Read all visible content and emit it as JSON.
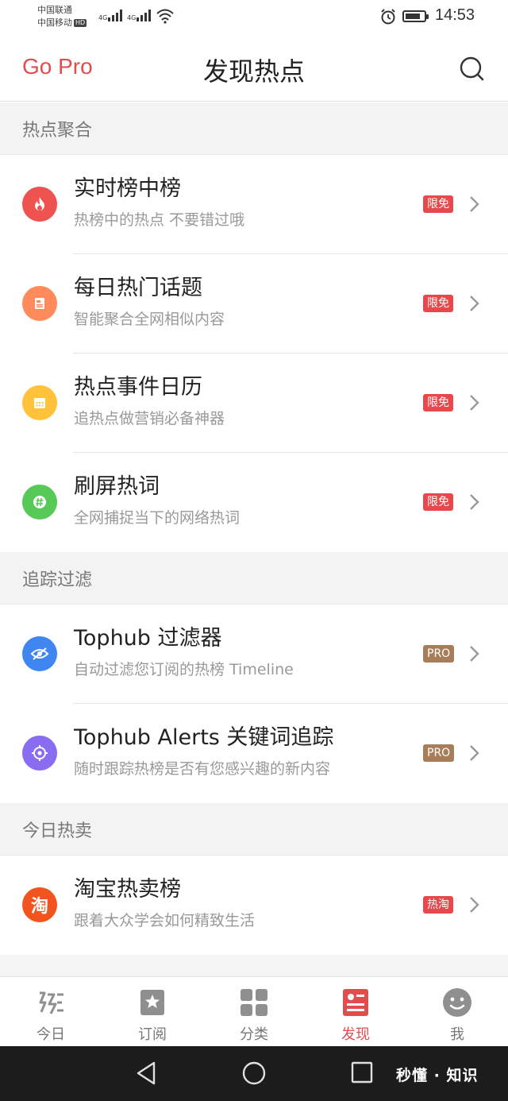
{
  "status_bar": {
    "carrier1": "中国联通",
    "carrier2": "中国移动",
    "hd": "HD",
    "net1": "4G",
    "net2": "4G",
    "time": "14:53",
    "battery_level": 0.8
  },
  "nav": {
    "go_pro": "Go Pro",
    "title": "发现热点",
    "search_icon": "search-icon"
  },
  "sections": [
    {
      "title": "热点聚合",
      "items": [
        {
          "title": "实时榜中榜",
          "subtitle": "热榜中的热点 不要错过哦",
          "badge": "限免",
          "icon": "flame-icon",
          "color": "#ef5350"
        },
        {
          "title": "每日热门话题",
          "subtitle": "智能聚合全网相似内容",
          "badge": "限免",
          "icon": "document-icon",
          "color": "#ff8a5b"
        },
        {
          "title": "热点事件日历",
          "subtitle": "追热点做营销必备神器",
          "badge": "限免",
          "icon": "calendar-icon",
          "color": "#ffc23a"
        },
        {
          "title": "刷屏热词",
          "subtitle": "全网捕捉当下的网络热词",
          "badge": "限免",
          "icon": "hashtag-icon",
          "color": "#56c957"
        }
      ]
    },
    {
      "title": "追踪过滤",
      "items": [
        {
          "title": "Tophub 过滤器",
          "subtitle": "自动过滤您订阅的热榜 Timeline",
          "badge": "PRO",
          "icon": "eye-off-icon",
          "color": "#3f86f0"
        },
        {
          "title": "Tophub Alerts 关键词追踪",
          "subtitle": "随时跟踪热榜是否有您感兴趣的新内容",
          "badge": "PRO",
          "icon": "target-icon",
          "color": "#8a6cf0"
        }
      ]
    },
    {
      "title": "今日热卖",
      "items": [
        {
          "title": "淘宝热卖榜",
          "subtitle": "跟着大众学会如何精致生活",
          "badge": "热淘",
          "icon": "taobao-icon",
          "icon_text": "淘",
          "color": "#f2541f"
        }
      ]
    }
  ],
  "tabs": [
    {
      "label": "今日",
      "icon": "today-icon"
    },
    {
      "label": "订阅",
      "icon": "star-bookmark-icon"
    },
    {
      "label": "分类",
      "icon": "grid-icon"
    },
    {
      "label": "发现",
      "icon": "discover-icon",
      "active": true
    },
    {
      "label": "我",
      "icon": "smiley-icon"
    }
  ],
  "system_nav": {
    "watermark": "秒懂 · 知识"
  },
  "colors": {
    "accent": "#e14d4d",
    "badge_free": "#e8474b",
    "badge_pro": "#a87d5a"
  }
}
